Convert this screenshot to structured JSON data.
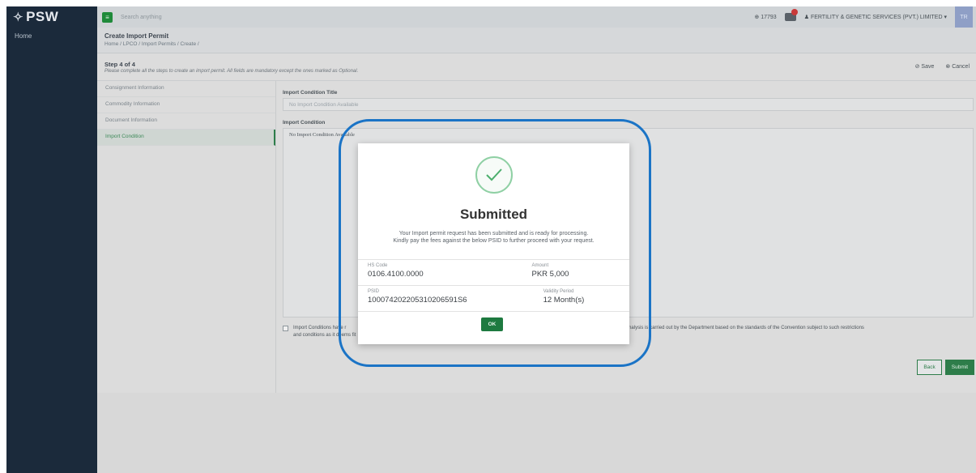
{
  "brand": {
    "logo_text": "PSW",
    "logo_symbol": "✧"
  },
  "sidebar": {
    "items": [
      {
        "label": "Home"
      }
    ]
  },
  "topbar": {
    "search_placeholder": "Search anything",
    "count": "17793",
    "company": "FERTILITY & GENETIC SERVICES (PVT.) LIMITED",
    "avatar_initials": "TR"
  },
  "header": {
    "title": "Create Import Permit",
    "breadcrumb": "Home / LPCO / Import Permits / Create /"
  },
  "step": {
    "title": "Step 4 of 4",
    "description": "Please complete all the steps to create an import permit. All fields are mandatory except the ones marked as Optional.",
    "save_label": "Save",
    "cancel_label": "Cancel"
  },
  "steps": [
    {
      "label": "Consignment Information"
    },
    {
      "label": "Commodity Information"
    },
    {
      "label": "Document Information"
    },
    {
      "label": "Import Condition"
    }
  ],
  "form": {
    "title_label": "Import Condition Title",
    "title_value": "No Import Condition Available",
    "condition_label": "Import Condition",
    "condition_value": "No Import Condition Available",
    "consent_part1": "Import Conditions have r",
    "consent_part2": "e unless the pest risk analysis is carried out by the Department based on the standards of the Convention subject to such restrictions",
    "consent_part3": "and conditions as it deems fit",
    "back_label": "Back",
    "submit_label": "Submit"
  },
  "modal": {
    "title": "Submitted",
    "message_line1": "Your Import permit request has been submitted and is ready for processing.",
    "message_line2": "Kindly pay the fees against the below PSID to further proceed with your request.",
    "hs_code_label": "HS Code",
    "hs_code_value": "0106.4100.0000",
    "amount_label": "Amount",
    "amount_value": "PKR 5,000",
    "psid_label": "PSID",
    "psid_value": "100074202205310206591S6",
    "validity_label": "Validity Period",
    "validity_value": "12 Month(s)",
    "ok_label": "OK"
  },
  "colors": {
    "brand_green": "#2e7d4a",
    "annotation_blue": "#1b74c6",
    "sidebar_navy": "#1b2a3b"
  }
}
